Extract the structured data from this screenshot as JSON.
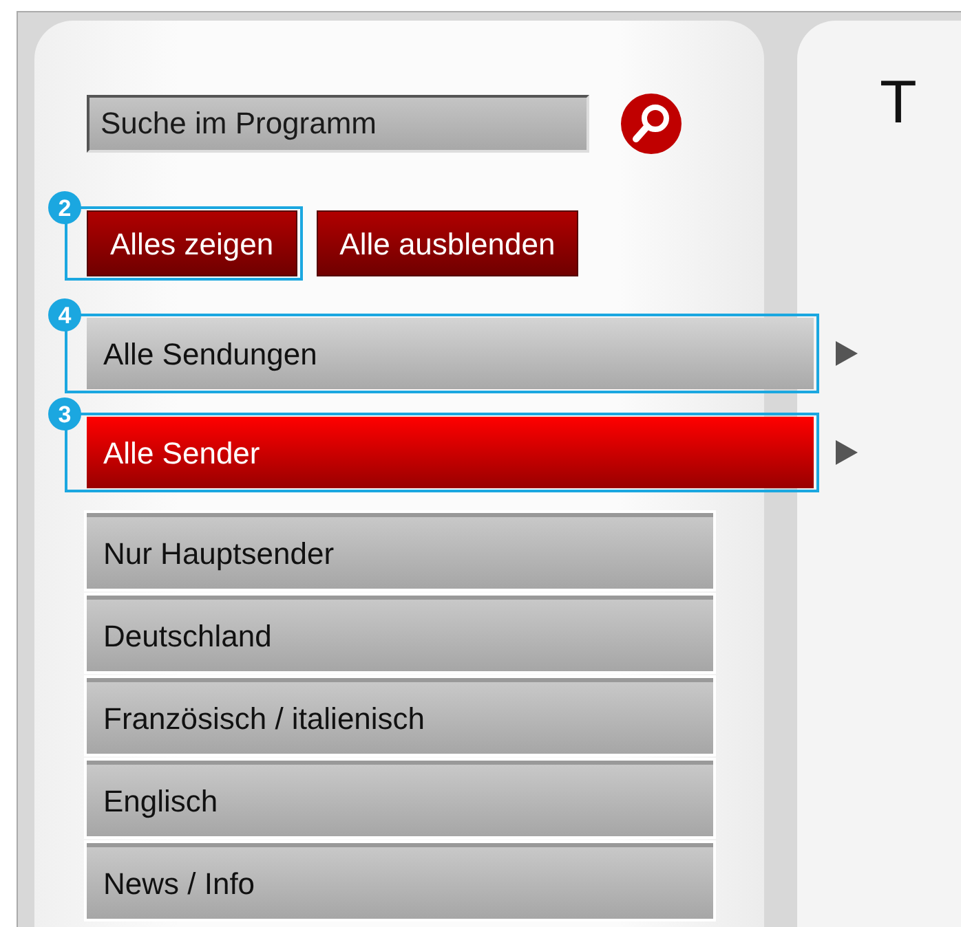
{
  "search": {
    "placeholder": "Suche im Programm"
  },
  "buttons": [
    {
      "label": "Alles zeigen",
      "callout": "2"
    },
    {
      "label": "Alle ausblenden"
    }
  ],
  "categories": [
    {
      "label": "Alle Sendungen",
      "selected": false,
      "callout": "4"
    },
    {
      "label": "Alle Sender",
      "selected": true,
      "callout": "3"
    }
  ],
  "sub_items": [
    {
      "label": "Nur Hauptsender"
    },
    {
      "label": "Deutschland"
    },
    {
      "label": "Französisch / italienisch"
    },
    {
      "label": "Englisch"
    },
    {
      "label": "News / Info"
    }
  ],
  "content": {
    "title": "T"
  }
}
